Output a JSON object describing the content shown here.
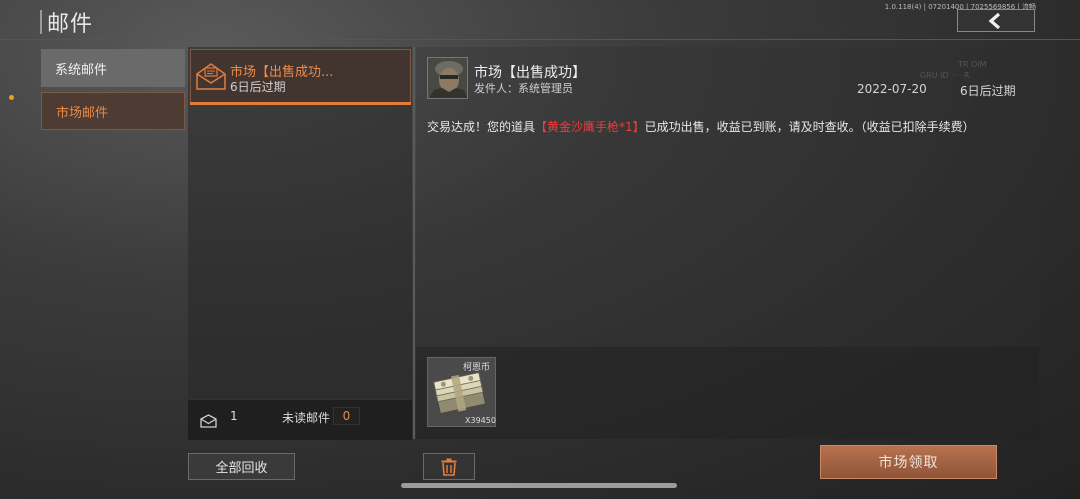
{
  "header": {
    "title": "邮件",
    "version": "1.0.118(4) | 07201400 | 7025569856 | 流畅"
  },
  "categories": [
    {
      "label": "系统邮件",
      "selected": false
    },
    {
      "label": "市场邮件",
      "selected": true
    }
  ],
  "mail_list": {
    "items": [
      {
        "title": "市场【出售成功...",
        "expiry": "6日后过期",
        "selected": true
      }
    ],
    "total_count": "1",
    "unread_label": "未读邮件",
    "unread_count": "0",
    "collect_all_label": "全部回收"
  },
  "detail": {
    "title": "市场【出售成功】",
    "sender_label": "发件人：",
    "sender_name": "系统管理员",
    "date": "2022-07-20",
    "expiry": "6日后过期",
    "watermark_1": "TR OIM",
    "watermark_2": "GRU ID ···· R",
    "message_prefix": "交易达成！您的道具",
    "message_item": "【黄金沙鹰手枪*1】",
    "message_suffix": "已成功出售，收益已到账，请及时查收。（收益已扣除手续费）",
    "attachment": {
      "name": "柯恩币",
      "quantity": "X39450"
    },
    "claim_label": "市场领取"
  },
  "colors": {
    "accent": "#e37d3e",
    "highlight_red": "#ef3b3b",
    "claim_button": "#a5633f"
  },
  "icons": [
    "back-arrow-icon",
    "envelope-icon",
    "mail-icon",
    "trash-icon",
    "cash-bundle-icon"
  ]
}
